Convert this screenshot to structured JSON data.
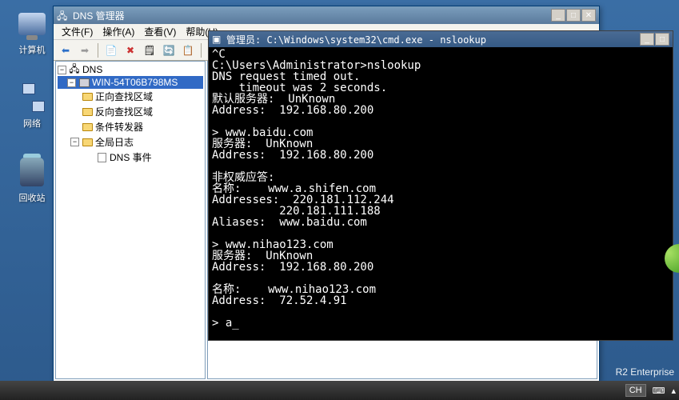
{
  "desktop": {
    "icons": [
      {
        "name": "computer",
        "label": "计算机"
      },
      {
        "name": "network",
        "label": "网络"
      },
      {
        "name": "recycle",
        "label": "回收站"
      }
    ]
  },
  "dns_window": {
    "title": "DNS 管理器",
    "menu": {
      "file": "文件(F)",
      "action": "操作(A)",
      "view": "查看(V)",
      "help": "帮助(H)"
    },
    "tree": {
      "root": "DNS",
      "server": "WIN-54T06B798MS",
      "forward": "正向查找区域",
      "reverse": "反向查找区域",
      "conditional": "条件转发器",
      "global_log": "全局日志",
      "dns_events": "DNS 事件"
    }
  },
  "cmd_window": {
    "title": "管理员: C:\\Windows\\system32\\cmd.exe - nslookup",
    "lines": [
      "^C",
      "C:\\Users\\Administrator>nslookup",
      "DNS request timed out.",
      "    timeout was 2 seconds.",
      "默认服务器:  UnKnown",
      "Address:  192.168.80.200",
      "",
      "> www.baidu.com",
      "服务器:  UnKnown",
      "Address:  192.168.80.200",
      "",
      "非权威应答:",
      "名称:    www.a.shifen.com",
      "Addresses:  220.181.112.244",
      "          220.181.111.188",
      "Aliases:  www.baidu.com",
      "",
      "> www.nihao123.com",
      "服务器:  UnKnown",
      "Address:  192.168.80.200",
      "",
      "名称:    www.nihao123.com",
      "Address:  72.52.4.91",
      "",
      "> a_"
    ]
  },
  "taskbar": {
    "lang": "CH",
    "watermark": "R2 Enterprise"
  }
}
